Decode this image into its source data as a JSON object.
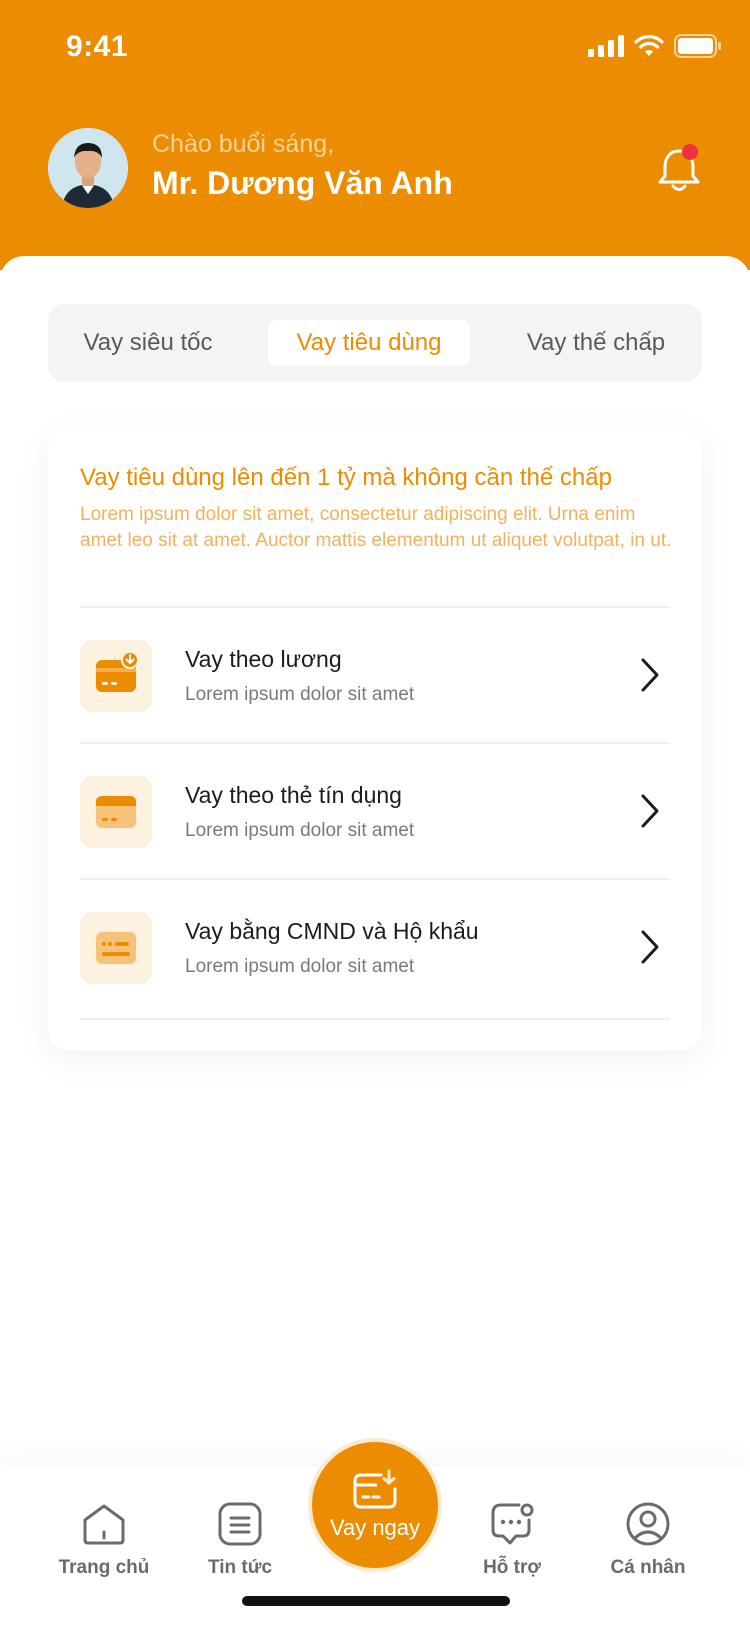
{
  "status_bar": {
    "time": "9:41"
  },
  "header": {
    "greeting": "Chào buổi sáng,",
    "username": "Mr. Dương Văn Anh",
    "notification_dot_color": "#F0323C"
  },
  "tabs": [
    {
      "label": "Vay siêu tốc",
      "active": false
    },
    {
      "label": "Vay tiêu dùng",
      "active": true
    },
    {
      "label": "Vay thế chấp",
      "active": false
    }
  ],
  "promo": {
    "title": "Vay tiêu dùng lên đến 1 tỷ mà không cần thế chấp",
    "description": "Lorem ipsum dolor sit amet, consectetur adipiscing elit. Urna enim amet leo sit at amet. Auctor mattis elementum ut aliquet volutpat, in ut."
  },
  "loan_options": [
    {
      "title": "Vay theo lương",
      "subtitle": "Lorem ipsum dolor sit amet",
      "icon": "salary-card-icon"
    },
    {
      "title": "Vay theo thẻ tín dụng",
      "subtitle": "Lorem ipsum dolor sit amet",
      "icon": "credit-card-icon"
    },
    {
      "title": "Vay bằng CMND và Hộ khẩu",
      "subtitle": "Lorem ipsum dolor sit amet",
      "icon": "id-card-icon"
    }
  ],
  "bottom_nav": {
    "home": "Trang chủ",
    "news": "Tin tức",
    "cta": "Vay ngay",
    "support": "Hỗ trợ",
    "profile": "Cá nhân"
  },
  "colors": {
    "accent": "#EC8C00",
    "accent_light": "#FDF1E0",
    "accent_text_soft": "#F2B15C"
  }
}
